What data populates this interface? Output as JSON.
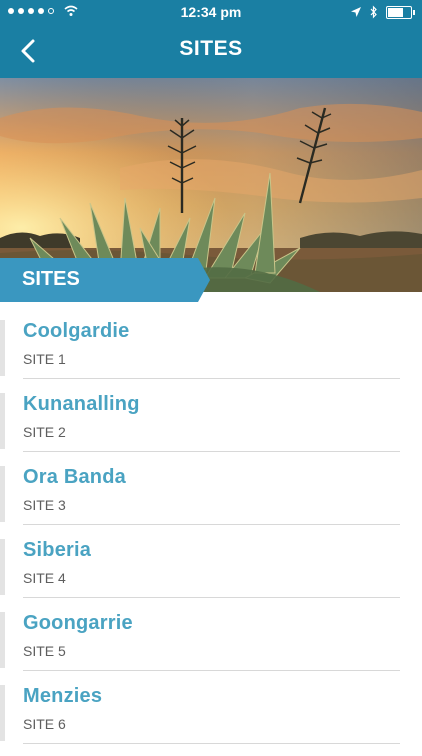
{
  "status_bar": {
    "time": "12:34 pm"
  },
  "nav": {
    "title": "SITES",
    "back_icon": "chevron-left-icon"
  },
  "hero": {
    "section_label": "SITES",
    "tab_color": "#3a97c0"
  },
  "colors": {
    "bar_blue": "#1a7fa3",
    "site_name": "#4aa3c2"
  },
  "sites": [
    {
      "name": "Coolgardie",
      "code": "SITE 1"
    },
    {
      "name": "Kunanalling",
      "code": "SITE 2"
    },
    {
      "name": "Ora Banda",
      "code": "SITE 3"
    },
    {
      "name": "Siberia",
      "code": "SITE 4"
    },
    {
      "name": "Goongarrie",
      "code": "SITE 5"
    },
    {
      "name": "Menzies",
      "code": "SITE 6"
    }
  ]
}
